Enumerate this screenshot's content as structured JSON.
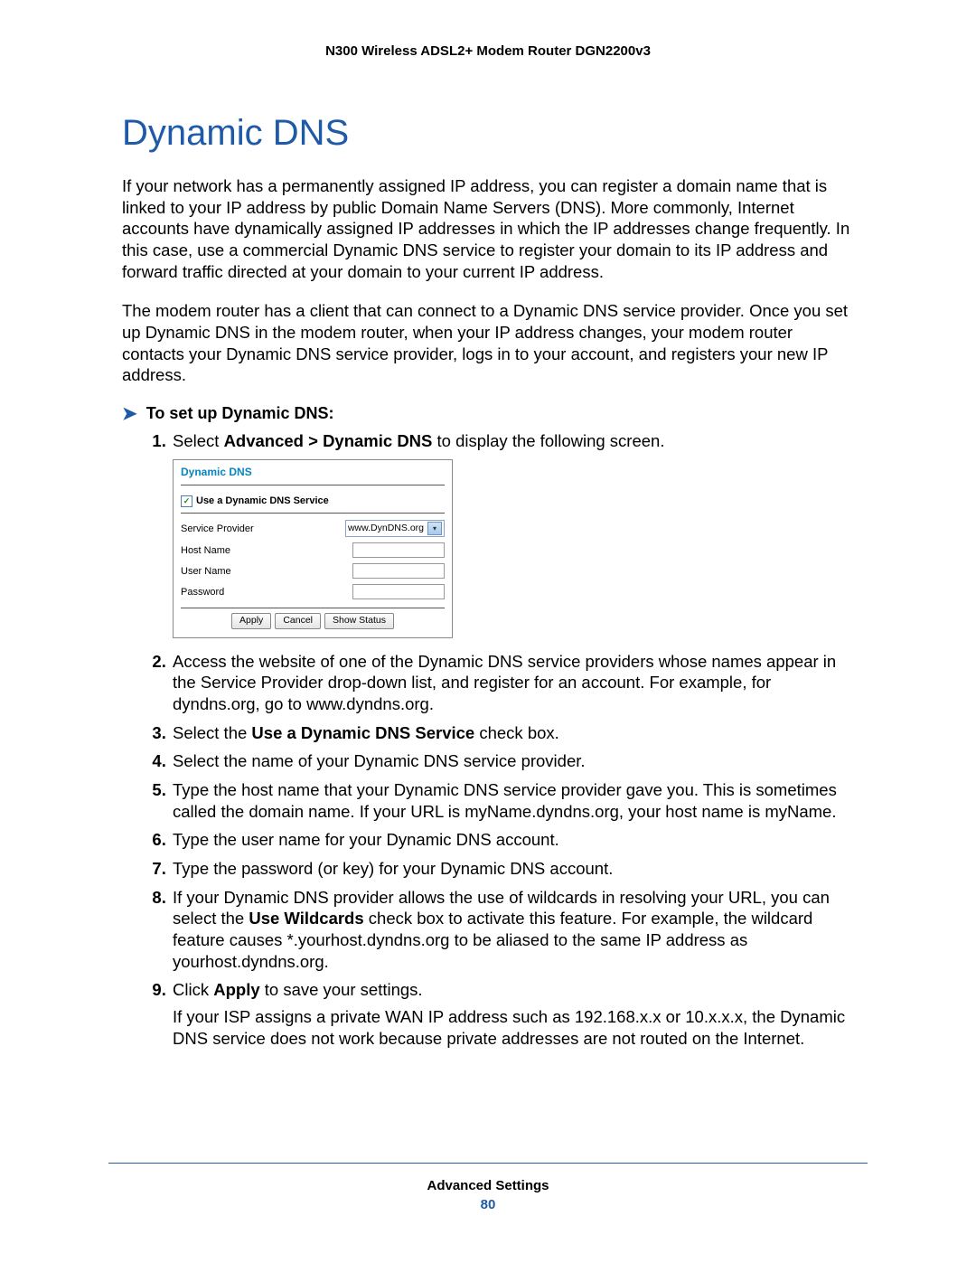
{
  "header": {
    "product": "N300 Wireless ADSL2+ Modem Router DGN2200v3"
  },
  "section": {
    "title": "Dynamic DNS"
  },
  "intro": {
    "p1": "If your network has a permanently assigned IP address, you can register a domain name that is linked to your IP address by public Domain Name Servers (DNS). More commonly, Internet accounts have dynamically assigned IP addresses in which the IP addresses change frequently. In this case, use a commercial Dynamic DNS service to register your domain to its IP address and forward traffic directed at your domain to your current IP address.",
    "p2": "The modem router has a client that can connect to a Dynamic DNS service provider. Once you set up Dynamic DNS in the modem router, when your IP address changes, your modem router contacts your Dynamic DNS service provider, logs in to your account, and registers your new IP address."
  },
  "task": {
    "title": "To set up Dynamic DNS:"
  },
  "steps": {
    "s1a": "Select ",
    "s1b": "Advanced > Dynamic DNS",
    "s1c": " to display the following screen.",
    "s2": "Access the website of one of the Dynamic DNS service providers whose names appear in the Service Provider drop-down list, and register for an account. For example, for dyndns.org, go to www.dyndns.org.",
    "s3a": "Select the ",
    "s3b": "Use a Dynamic DNS Service",
    "s3c": " check box.",
    "s4": "Select the name of your Dynamic DNS service provider.",
    "s5": "Type the host name that your Dynamic DNS service provider gave you. This is sometimes called the domain name. If your URL is myName.dyndns.org, your host name is myName.",
    "s6": "Type the user name for your Dynamic DNS account.",
    "s7": "Type the password (or key) for your Dynamic DNS account.",
    "s8a": "If your Dynamic DNS provider allows the use of wildcards in resolving your URL, you can select the ",
    "s8b": "Use Wildcards",
    "s8c": " check box to activate this feature. For example, the wildcard feature causes *.yourhost.dyndns.org to be aliased to the same IP address as yourhost.dyndns.org.",
    "s9a": "Click ",
    "s9b": "Apply",
    "s9c": " to save your settings.",
    "s9note": "If your ISP assigns a private WAN IP address such as 192.168.x.x or 10.x.x.x, the Dynamic DNS service does not work because private addresses are not routed on the Internet."
  },
  "panel": {
    "title": "Dynamic DNS",
    "checkbox": "Use a Dynamic DNS Service",
    "labels": {
      "service": "Service Provider",
      "host": "Host Name",
      "user": "User Name",
      "pass": "Password"
    },
    "select_value": "www.DynDNS.org",
    "buttons": {
      "apply": "Apply",
      "cancel": "Cancel",
      "status": "Show Status"
    }
  },
  "footer": {
    "chapter": "Advanced Settings",
    "page": "80"
  }
}
